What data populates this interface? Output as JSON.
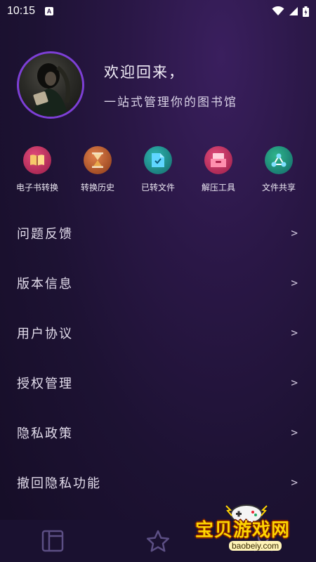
{
  "status_bar": {
    "time": "10:15",
    "notification_badge": "A"
  },
  "profile": {
    "title": "欢迎回来，",
    "subtitle": "一站式管理你的图书馆"
  },
  "quick_actions": [
    {
      "label": "电子书转换",
      "icon": "book-icon",
      "color": "#c8305a"
    },
    {
      "label": "转换历史",
      "icon": "hourglass-icon",
      "color": "#b8562a"
    },
    {
      "label": "已转文件",
      "icon": "file-check-icon",
      "color": "#1f8a8a"
    },
    {
      "label": "解压工具",
      "icon": "archive-icon",
      "color": "#c8305a"
    },
    {
      "label": "文件共享",
      "icon": "share-icon",
      "color": "#1f8a8a"
    }
  ],
  "menu": [
    {
      "label": "问题反馈",
      "chevron": ">"
    },
    {
      "label": "版本信息",
      "chevron": ">"
    },
    {
      "label": "用户协议",
      "chevron": ">"
    },
    {
      "label": "授权管理",
      "chevron": ">"
    },
    {
      "label": "隐私政策",
      "chevron": ">"
    },
    {
      "label": "撤回隐私功能",
      "chevron": ">"
    }
  ],
  "tab_bar": {
    "tabs": [
      {
        "icon": "library-icon"
      },
      {
        "icon": "star-icon"
      },
      {
        "icon": "profile-icon"
      }
    ]
  },
  "watermark": {
    "text": "宝贝游戏网",
    "url": "baobeiy.com"
  },
  "colors": {
    "accent": "#7d3fd6",
    "background": "#1d1233"
  }
}
